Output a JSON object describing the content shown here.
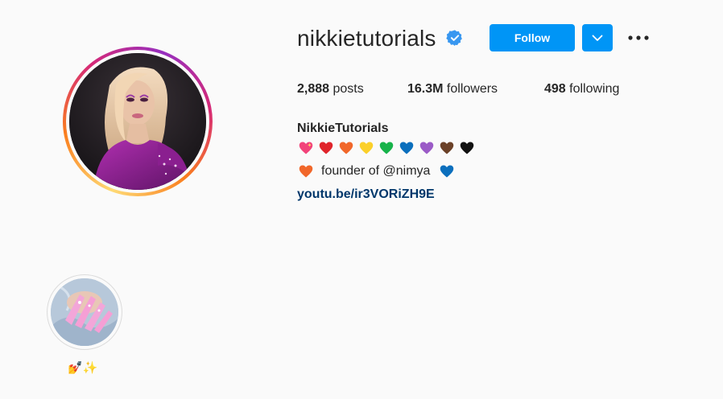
{
  "profile": {
    "username": "nikkietutorials",
    "verified": true,
    "follow_label": "Follow",
    "stats": [
      {
        "value": "2,888",
        "label": "posts"
      },
      {
        "value": "16.3M",
        "label": "followers"
      },
      {
        "value": "498",
        "label": "following"
      }
    ],
    "bio": {
      "display_name": "NikkieTutorials",
      "heart_colors": [
        "#f2437a",
        "#e0242b",
        "#f1672a",
        "#fbd02a",
        "#17b34a",
        "#0b6fbd",
        "#9b5bc7",
        "#6b4128",
        "#111111"
      ],
      "founder_text": "founder of @nimya",
      "founder_heart_left": "#f1672a",
      "founder_heart_right": "#0b6fbd",
      "link": "youtu.be/ir3VORiZH9E"
    }
  },
  "highlights": [
    {
      "label": "💅✨"
    }
  ],
  "colors": {
    "accent": "#0095f6",
    "link": "#00376b",
    "verified": "#3897f0"
  }
}
